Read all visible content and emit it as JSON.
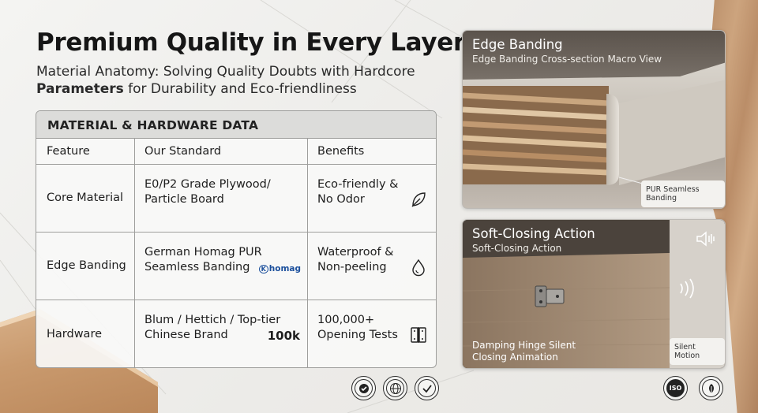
{
  "header": {
    "title": "Premium Quality in Every Layer",
    "subtitle_line1": "Material Anatomy: Solving Quality Doubts with Hardcore",
    "subtitle_bold": "Parameters",
    "subtitle_rest": "for Durability and Eco-friendliness"
  },
  "table": {
    "title": "MATERIAL & HARDWARE DATA",
    "columns": [
      "Feature",
      "Our Standard",
      "Benefits"
    ],
    "rows": [
      {
        "feature": "Core Material",
        "standard": "E0/P2 Grade Plywood/ Particle Board",
        "benefit": "Eco-friendly & No Odor",
        "icon": "leaf-icon"
      },
      {
        "feature": "Edge Banding",
        "standard": "German Homag PUR Seamless Banding",
        "brand": "homag",
        "brand_mark": "K",
        "benefit": "Waterproof & Non-peeling",
        "icon": "water-drop-icon"
      },
      {
        "feature": "Hardware",
        "standard": "Blum / Hettich / Top-tier Chinese Brand",
        "tag": "100k",
        "benefit": "100,000+ Opening Tests",
        "icon": "hinge-icon"
      }
    ]
  },
  "cards": {
    "edge": {
      "title": "Edge Banding",
      "subtitle": "Edge Banding Cross-section Macro View",
      "label": "PUR Seamless Banding"
    },
    "soft": {
      "title": "Soft-Closing Action",
      "subtitle": "Soft-Closing Action",
      "caption": "Damping Hinge Silent Closing Animation",
      "label": "Silent Motion",
      "icon": "speaker-icon"
    }
  },
  "badges": {
    "iso": "ISO"
  },
  "colors": {
    "accent_blue": "#1b4f9c",
    "table_header": "#dcdcda",
    "wood": "#c99c72"
  }
}
